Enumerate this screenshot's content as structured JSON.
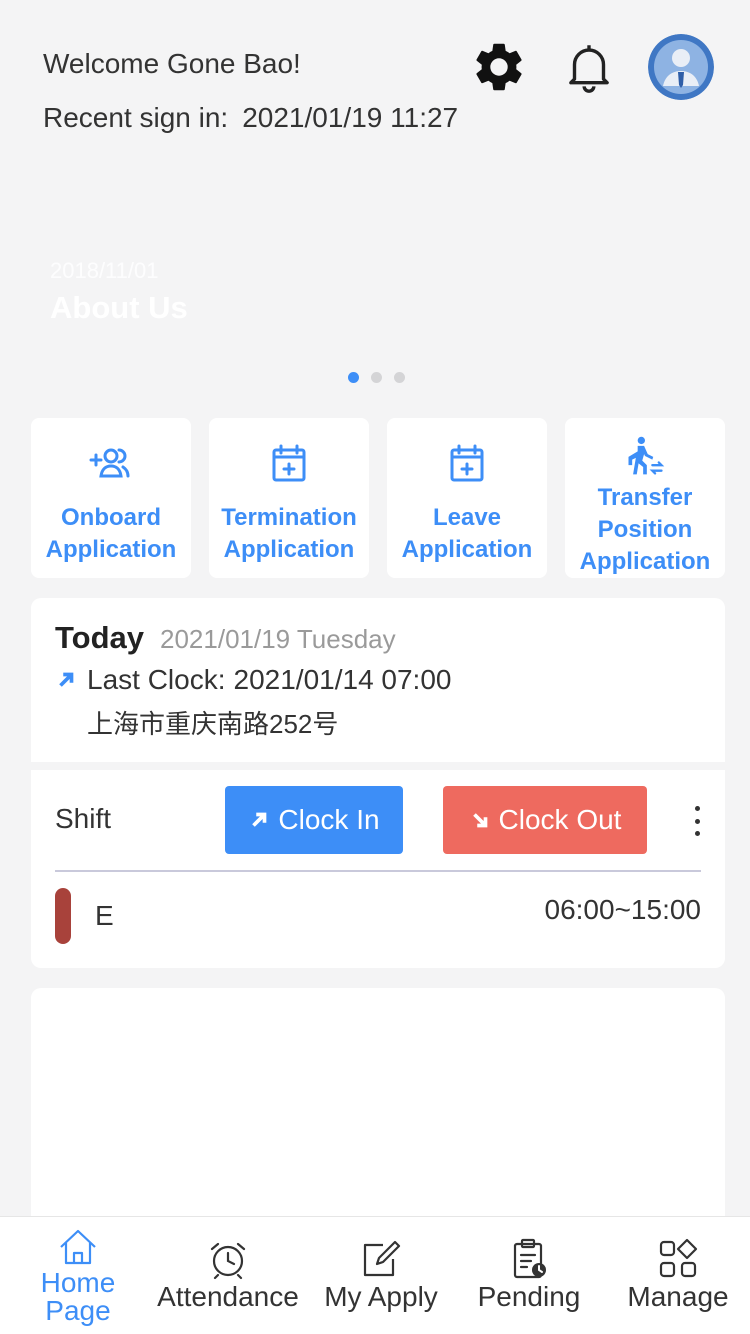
{
  "header": {
    "welcome": "Welcome Gone Bao!",
    "signin_label": "Recent sign in:",
    "signin_value": "2021/01/19 11:27",
    "icons": [
      "gear-icon",
      "bell-icon",
      "avatar"
    ]
  },
  "banner": {
    "date": "2018/11/01",
    "title": "About Us",
    "slide_count": 3,
    "active_slide": 1
  },
  "apps": [
    {
      "label": "Onboard Application",
      "icon": "add-user-icon"
    },
    {
      "label": "Termination Application",
      "icon": "calendar-add-icon"
    },
    {
      "label": "Leave Application",
      "icon": "calendar-add-icon"
    },
    {
      "label": "Transfer Position Application",
      "icon": "walk-transfer-icon"
    }
  ],
  "today": {
    "title": "Today",
    "date": "2021/01/19 Tuesday",
    "last_clock_label": "Last Clock:",
    "last_clock_value": "2021/01/14 07:00",
    "address": "上海市重庆南路252号"
  },
  "shift": {
    "label": "Shift",
    "clock_in": "Clock In",
    "clock_out": "Clock Out",
    "code": "E",
    "time": "06:00~15:00"
  },
  "tabs": [
    {
      "label": "Home Page",
      "icon": "home-icon",
      "active": true
    },
    {
      "label": "Attendance",
      "icon": "alarm-clock-icon"
    },
    {
      "label": "My Apply",
      "icon": "edit-icon"
    },
    {
      "label": "Pending",
      "icon": "clipboard-clock-icon"
    },
    {
      "label": "Manage",
      "icon": "grid-icon"
    }
  ],
  "colors": {
    "accent": "#3d8ef7",
    "clock_out": "#ee6a5f",
    "shift_bar": "#a8423b",
    "background": "#f4f4f5"
  }
}
